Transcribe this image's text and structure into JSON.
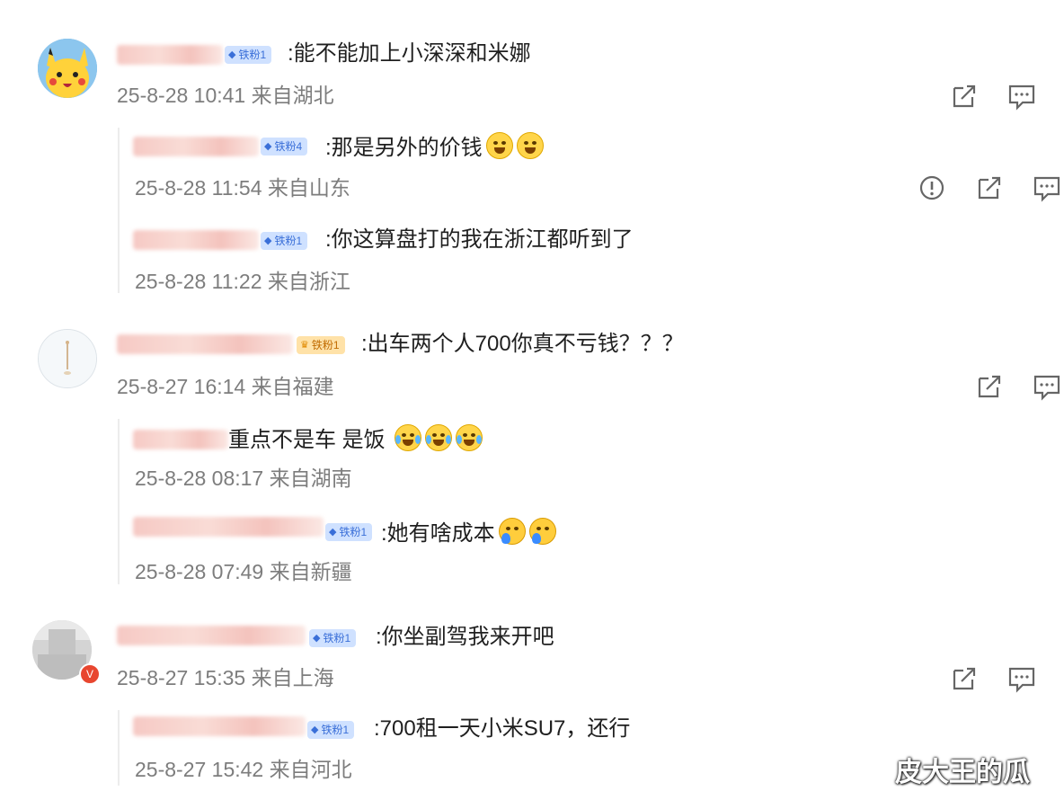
{
  "comments": [
    {
      "badge": "铁粉1",
      "text": ":能不能加上小深深和米娜",
      "meta": "25-8-28 10:41 来自湖北",
      "replies": [
        {
          "badge": "铁粉4",
          "text": ":那是另外的价钱",
          "meta": "25-8-28 11:54 来自山东"
        },
        {
          "badge": "铁粉1",
          "text": ":你这算盘打的我在浙江都听到了",
          "meta": "25-8-28 11:22 来自浙江"
        }
      ]
    },
    {
      "badge": "铁粉1",
      "text": ":出车两个人700你真不亏钱？？？",
      "meta": "25-8-27 16:14 来自福建",
      "replies": [
        {
          "text": "重点不是车 是饭",
          "meta": "25-8-28 08:17 来自湖南"
        },
        {
          "badge": "铁粉1",
          "text": ":她有啥成本",
          "meta": "25-8-28 07:49 来自新疆"
        }
      ]
    },
    {
      "badge": "铁粉1",
      "text": ":你坐副驾我来开吧",
      "meta": "25-8-27 15:35 来自上海",
      "replies": [
        {
          "badge": "铁粉1",
          "text": ":700租一天小米SU7，还行",
          "meta": "25-8-27 15:42 来自河北"
        }
      ]
    }
  ],
  "icons": {
    "share": "share-icon",
    "comment": "comment-icon",
    "report": "report-icon",
    "badge": "diamond-icon"
  },
  "watermark": "皮大王的瓜"
}
